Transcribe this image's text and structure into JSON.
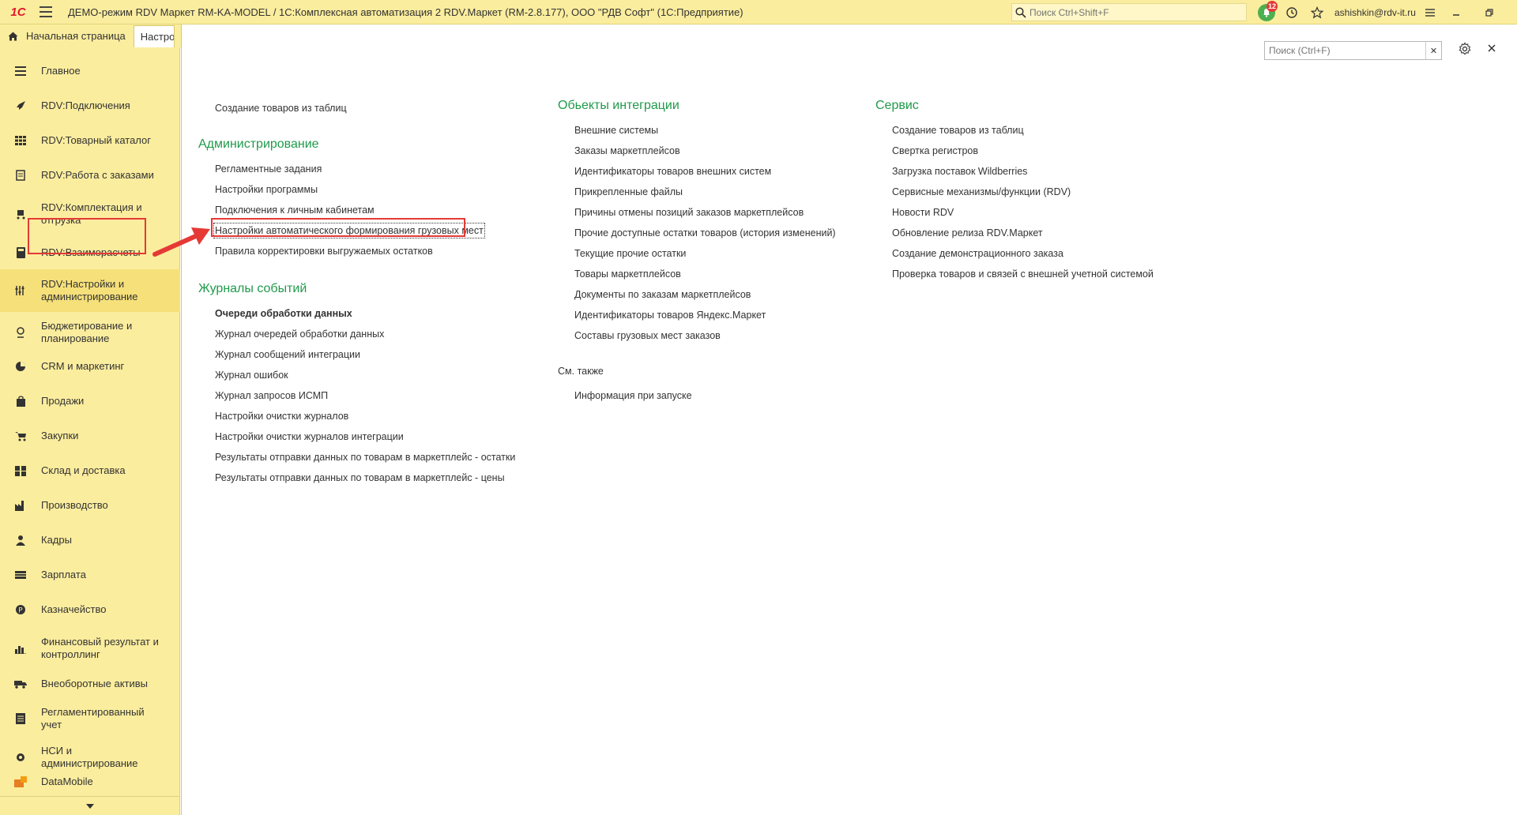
{
  "titlebar": {
    "logo": "1С",
    "title": "ДЕМО-режим RDV Маркет RM-KA-MODEL / 1С:Комплексная автоматизация 2 RDV.Маркет (RM-2.8.177), ООО \"РДВ Софт\"  (1С:Предприятие)",
    "search_placeholder": "Поиск Ctrl+Shift+F",
    "notifications_count": "12",
    "user": "ashishkin@rdv-it.ru"
  },
  "tabs": {
    "home": "Начальная страница",
    "active": "Настройки"
  },
  "sidebar": {
    "items": [
      {
        "label": "Главное",
        "icon": "menu-lines-icon"
      },
      {
        "label": "RDV:Подключения",
        "icon": "rocket-icon"
      },
      {
        "label": "RDV:Товарный каталог",
        "icon": "grid-icon"
      },
      {
        "label": "RDV:Работа с заказами",
        "icon": "document-icon"
      },
      {
        "label": "RDV:Комплектация и отгрузка",
        "icon": "cart-box-icon"
      },
      {
        "label": "RDV:Взаиморасчеты",
        "icon": "calculator-icon"
      },
      {
        "label": "RDV:Настройки и администрирование",
        "icon": "sliders-icon"
      },
      {
        "label": "Бюджетирование и планирование",
        "icon": "budget-icon"
      },
      {
        "label": "CRM и маркетинг",
        "icon": "pie-chart-icon"
      },
      {
        "label": "Продажи",
        "icon": "bag-icon"
      },
      {
        "label": "Закупки",
        "icon": "cart-icon"
      },
      {
        "label": "Склад и доставка",
        "icon": "warehouse-icon"
      },
      {
        "label": "Производство",
        "icon": "factory-icon"
      },
      {
        "label": "Кадры",
        "icon": "person-icon"
      },
      {
        "label": "Зарплата",
        "icon": "money-icon"
      },
      {
        "label": "Казначейство",
        "icon": "coin-icon"
      },
      {
        "label": "Финансовый результат и контроллинг",
        "icon": "bar-chart-icon"
      },
      {
        "label": "Внеоборотные активы",
        "icon": "truck-icon"
      },
      {
        "label": "Регламентированный учет",
        "icon": "ledger-icon"
      },
      {
        "label": "НСИ и администрирование",
        "icon": "gear-icon"
      },
      {
        "label": "DataMobile",
        "icon": "datamobile-icon"
      }
    ]
  },
  "form": {
    "search_placeholder": "Поиск (Ctrl+F)",
    "col1": {
      "top_link": "Создание товаров из таблиц",
      "admin_title": "Администрирование",
      "admin_links": [
        "Регламентные задания",
        "Настройки программы",
        "Подключения к личным кабинетам",
        "Настройки автоматического формирования грузовых мест",
        "Правила корректировки выгружаемых остатков"
      ],
      "journals_title": "Журналы событий",
      "journals_links": [
        "Очереди обработки данных",
        "Журнал очередей обработки данных",
        "Журнал сообщений интеграции",
        "Журнал ошибок",
        "Журнал запросов ИСМП",
        "Настройки очистки журналов",
        "Настройки очистки журналов интеграции",
        "Результаты отправки данных по товарам в маркетплейс - остатки",
        "Результаты отправки данных по товарам в маркетплейс - цены"
      ]
    },
    "col2": {
      "title": "Обьекты интеграции",
      "links": [
        "Внешние системы",
        "Заказы маркетплейсов",
        "Идентификаторы товаров внешних систем",
        "Прикрепленные файлы",
        "Причины отмены позиций заказов маркетплейсов",
        "Прочие доступные остатки товаров (история изменений)",
        "Текущие прочие остатки",
        "Товары маркетплейсов",
        "Документы по заказам маркетплейсов",
        "Идентификаторы товаров Яндекс.Маркет",
        "Составы грузовых мест заказов"
      ],
      "see_also": "См. также",
      "see_also_links": [
        "Информация при запуске"
      ]
    },
    "col3": {
      "title": "Сервис",
      "links": [
        "Создание товаров из таблиц",
        "Свертка регистров",
        "Загрузка поставок Wildberries",
        "Сервисные механизмы/функции (RDV)",
        "Новости RDV",
        "Обновление релиза RDV.Маркет",
        "Создание демонстрационного заказа",
        "Проверка товаров и связей с внешней учетной системой"
      ]
    }
  }
}
